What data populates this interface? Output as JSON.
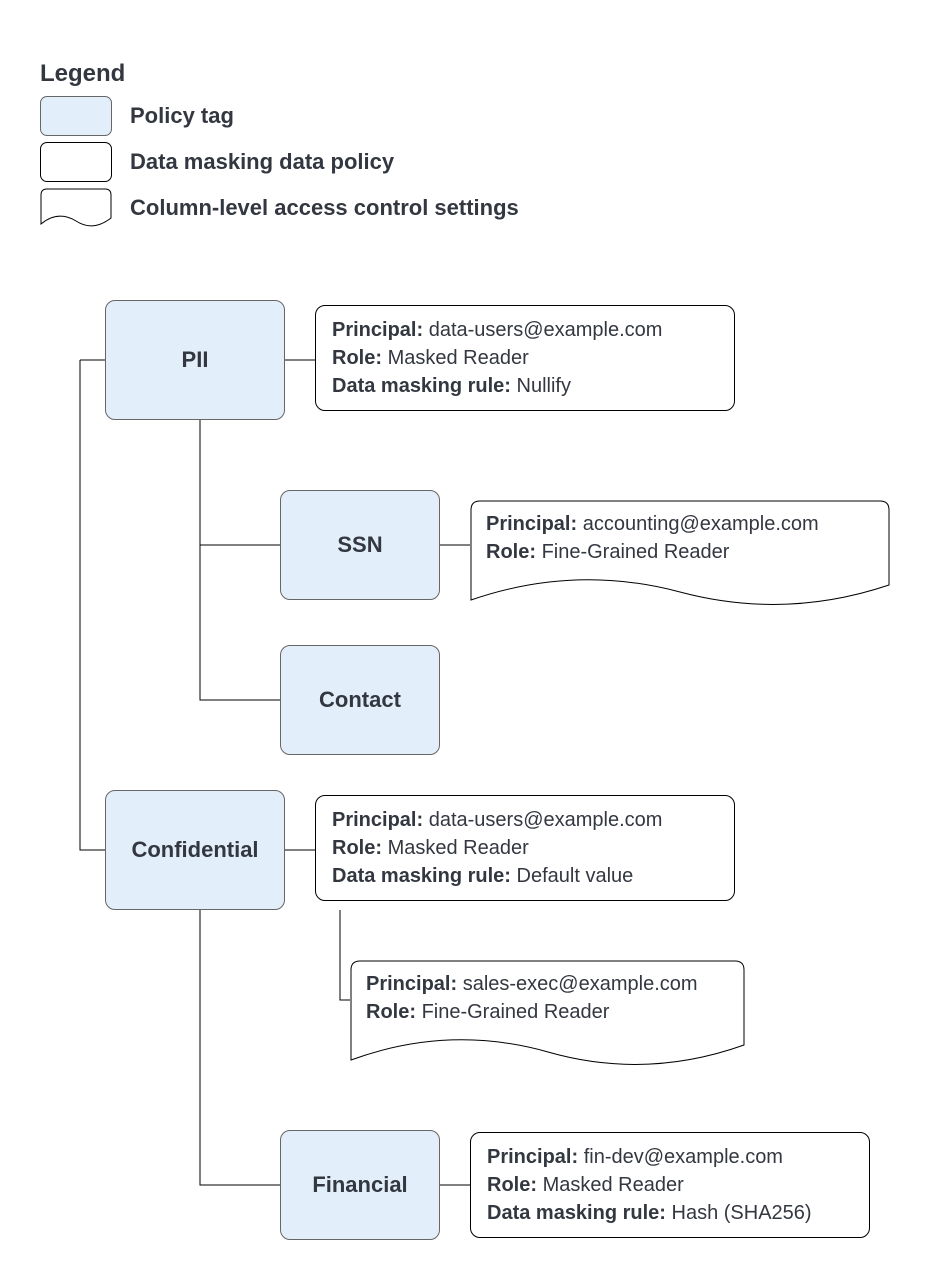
{
  "legend": {
    "title": "Legend",
    "tag": "Policy tag",
    "policy": "Data masking data policy",
    "access": "Column-level access control settings"
  },
  "labels": {
    "principal": "Principal:",
    "role": "Role:",
    "rule": "Data masking rule:"
  },
  "nodes": {
    "pii": {
      "name": "PII",
      "policy": {
        "principal": "data-users@example.com",
        "role": "Masked Reader",
        "rule": "Nullify"
      },
      "children": {
        "ssn": {
          "name": "SSN",
          "access": {
            "principal": "accounting@example.com",
            "role": "Fine-Grained Reader"
          }
        },
        "contact": {
          "name": "Contact"
        }
      }
    },
    "confidential": {
      "name": "Confidential",
      "policy": {
        "principal": "data-users@example.com",
        "role": "Masked Reader",
        "rule": "Default value"
      },
      "access": {
        "principal": "sales-exec@example.com",
        "role": "Fine-Grained Reader"
      },
      "children": {
        "financial": {
          "name": "Financial",
          "policy": {
            "principal": "fin-dev@example.com",
            "role": "Masked Reader",
            "rule": "Hash (SHA256)"
          }
        }
      }
    }
  }
}
